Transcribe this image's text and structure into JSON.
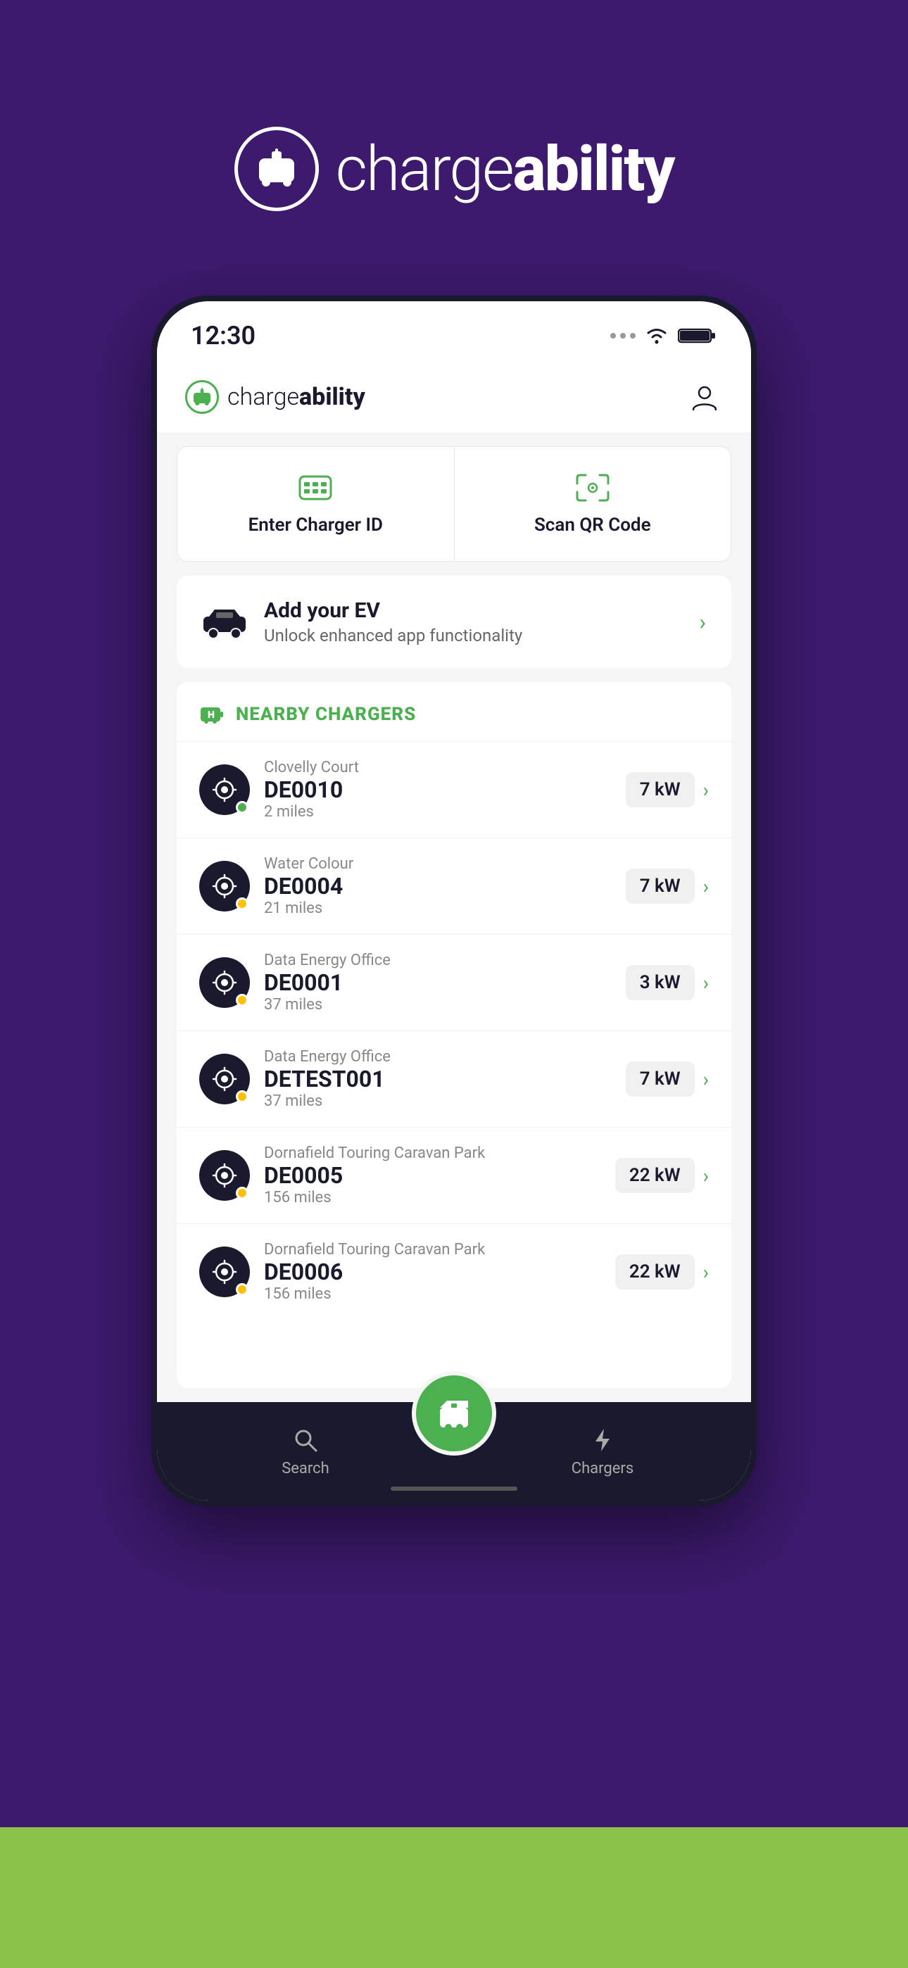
{
  "background_color": "#3d1a6e",
  "green_strip_color": "#8bc34a",
  "logo": {
    "text_light": "charge",
    "text_bold": "ability"
  },
  "status_bar": {
    "time": "12:30"
  },
  "app_header": {
    "logo_text_light": "charge",
    "logo_text_bold": "ability"
  },
  "actions": {
    "enter_charger_id": "Enter Charger ID",
    "scan_qr_code": "Scan QR Code"
  },
  "add_ev": {
    "title": "Add your EV",
    "subtitle": "Unlock enhanced app functionality"
  },
  "nearby_section": {
    "title": "NEARBY CHARGERS",
    "chargers": [
      {
        "location": "Clovelly Court",
        "id": "DE0010",
        "distance": "2 miles",
        "power": "7 kW",
        "status": "green"
      },
      {
        "location": "Water Colour",
        "id": "DE0004",
        "distance": "21 miles",
        "power": "7 kW",
        "status": "yellow"
      },
      {
        "location": "Data Energy Office",
        "id": "DE0001",
        "distance": "37 miles",
        "power": "3 kW",
        "status": "yellow"
      },
      {
        "location": "Data Energy Office",
        "id": "DETEST001",
        "distance": "37 miles",
        "power": "7 kW",
        "status": "yellow"
      },
      {
        "location": "Dornafield Touring Caravan Park",
        "id": "DE0005",
        "distance": "156 miles",
        "power": "22 kW",
        "status": "yellow"
      },
      {
        "location": "Dornafield Touring Caravan Park",
        "id": "DE0006",
        "distance": "156 miles",
        "power": "22 kW",
        "status": "yellow"
      }
    ]
  },
  "bottom_nav": {
    "search_label": "Search",
    "chargers_label": "Chargers"
  }
}
